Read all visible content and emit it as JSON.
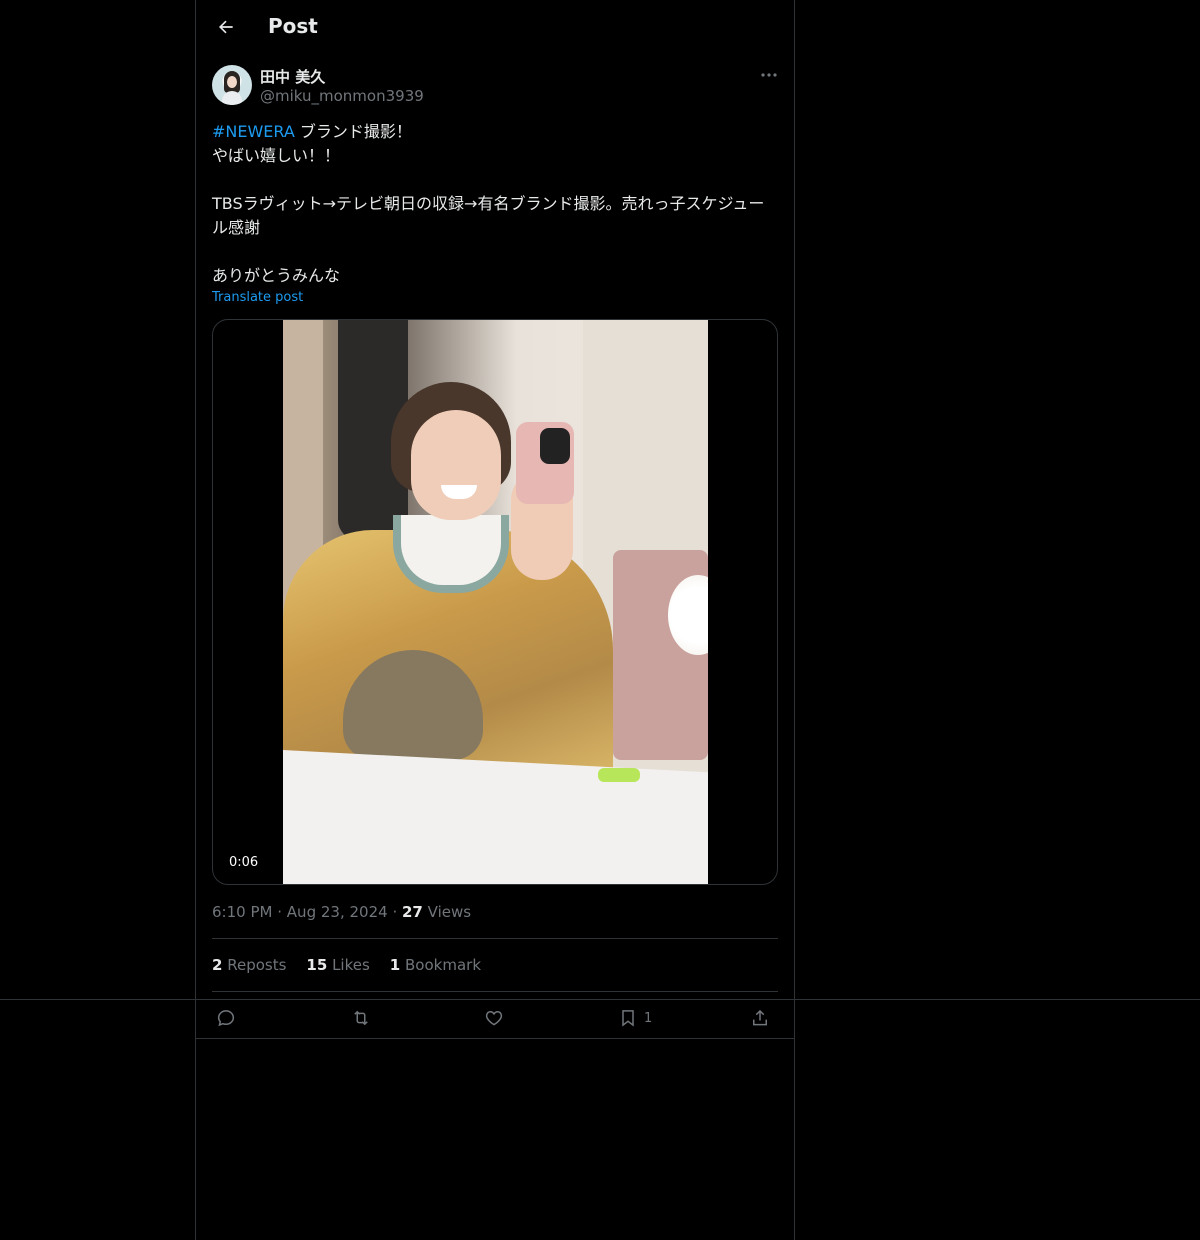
{
  "header": {
    "title": "Post",
    "back_icon": "back-arrow-icon"
  },
  "author": {
    "name": "田中 美久",
    "handle": "@miku_monmon3939"
  },
  "tweet": {
    "hashtag": "#NEWERA",
    "line1_rest": " ブランド撮影！",
    "body": "やばい嬉しい！！\n\nTBSラヴィット→テレビ朝日の収録→有名ブランド撮影。売れっ子スケジュール感謝\n\nありがとうみんな",
    "translate_label": "Translate post"
  },
  "media": {
    "timecode": "0:06"
  },
  "meta": {
    "time": "6:10 PM",
    "date": "Aug 23, 2024",
    "views_count": "27",
    "views_label": "Views",
    "separator": "·"
  },
  "stats": {
    "reposts_count": "2",
    "reposts_label": "Reposts",
    "likes_count": "15",
    "likes_label": "Likes",
    "bookmarks_count": "1",
    "bookmarks_label": "Bookmark"
  },
  "actions": {
    "bookmark_count": "1"
  },
  "colors": {
    "background": "#000000",
    "text": "#e7e9ea",
    "muted": "#71767b",
    "accent": "#1d9bf0",
    "border": "#2f3336"
  }
}
